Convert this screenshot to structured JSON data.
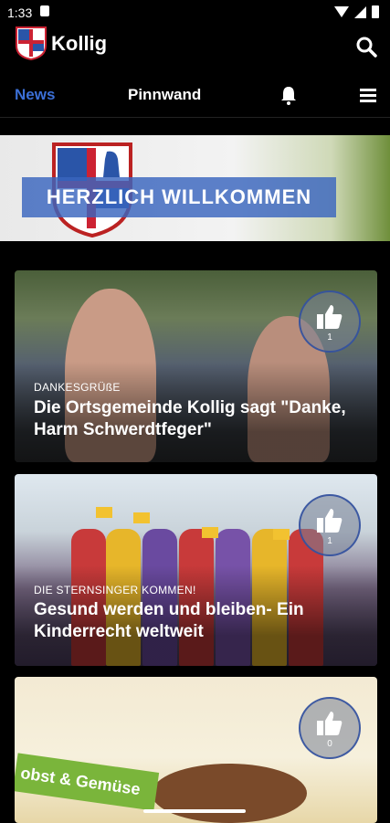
{
  "status_bar": {
    "time": "1:33"
  },
  "app_bar": {
    "title": "Kollig"
  },
  "nav": {
    "news": "News",
    "pinnwand": "Pinnwand"
  },
  "welcome": {
    "banner": "HERZLICH WILLKOMMEN"
  },
  "posts": [
    {
      "category": "DANKESGRÜßE",
      "title": "Die Ortsgemeinde Kollig sagt \"Danke, Harm Schwerdtfeger\"",
      "likes": "1"
    },
    {
      "category": "DIE STERNSINGER KOMMEN!",
      "title": "Gesund werden und bleiben- Ein Kinderrecht weltweit",
      "likes": "1"
    },
    {
      "category": "",
      "title": "",
      "likes": "0",
      "sign_text": "obst & Gemüse"
    }
  ],
  "colors": {
    "accent": "#3b6fd6",
    "banner": "#3965be"
  }
}
